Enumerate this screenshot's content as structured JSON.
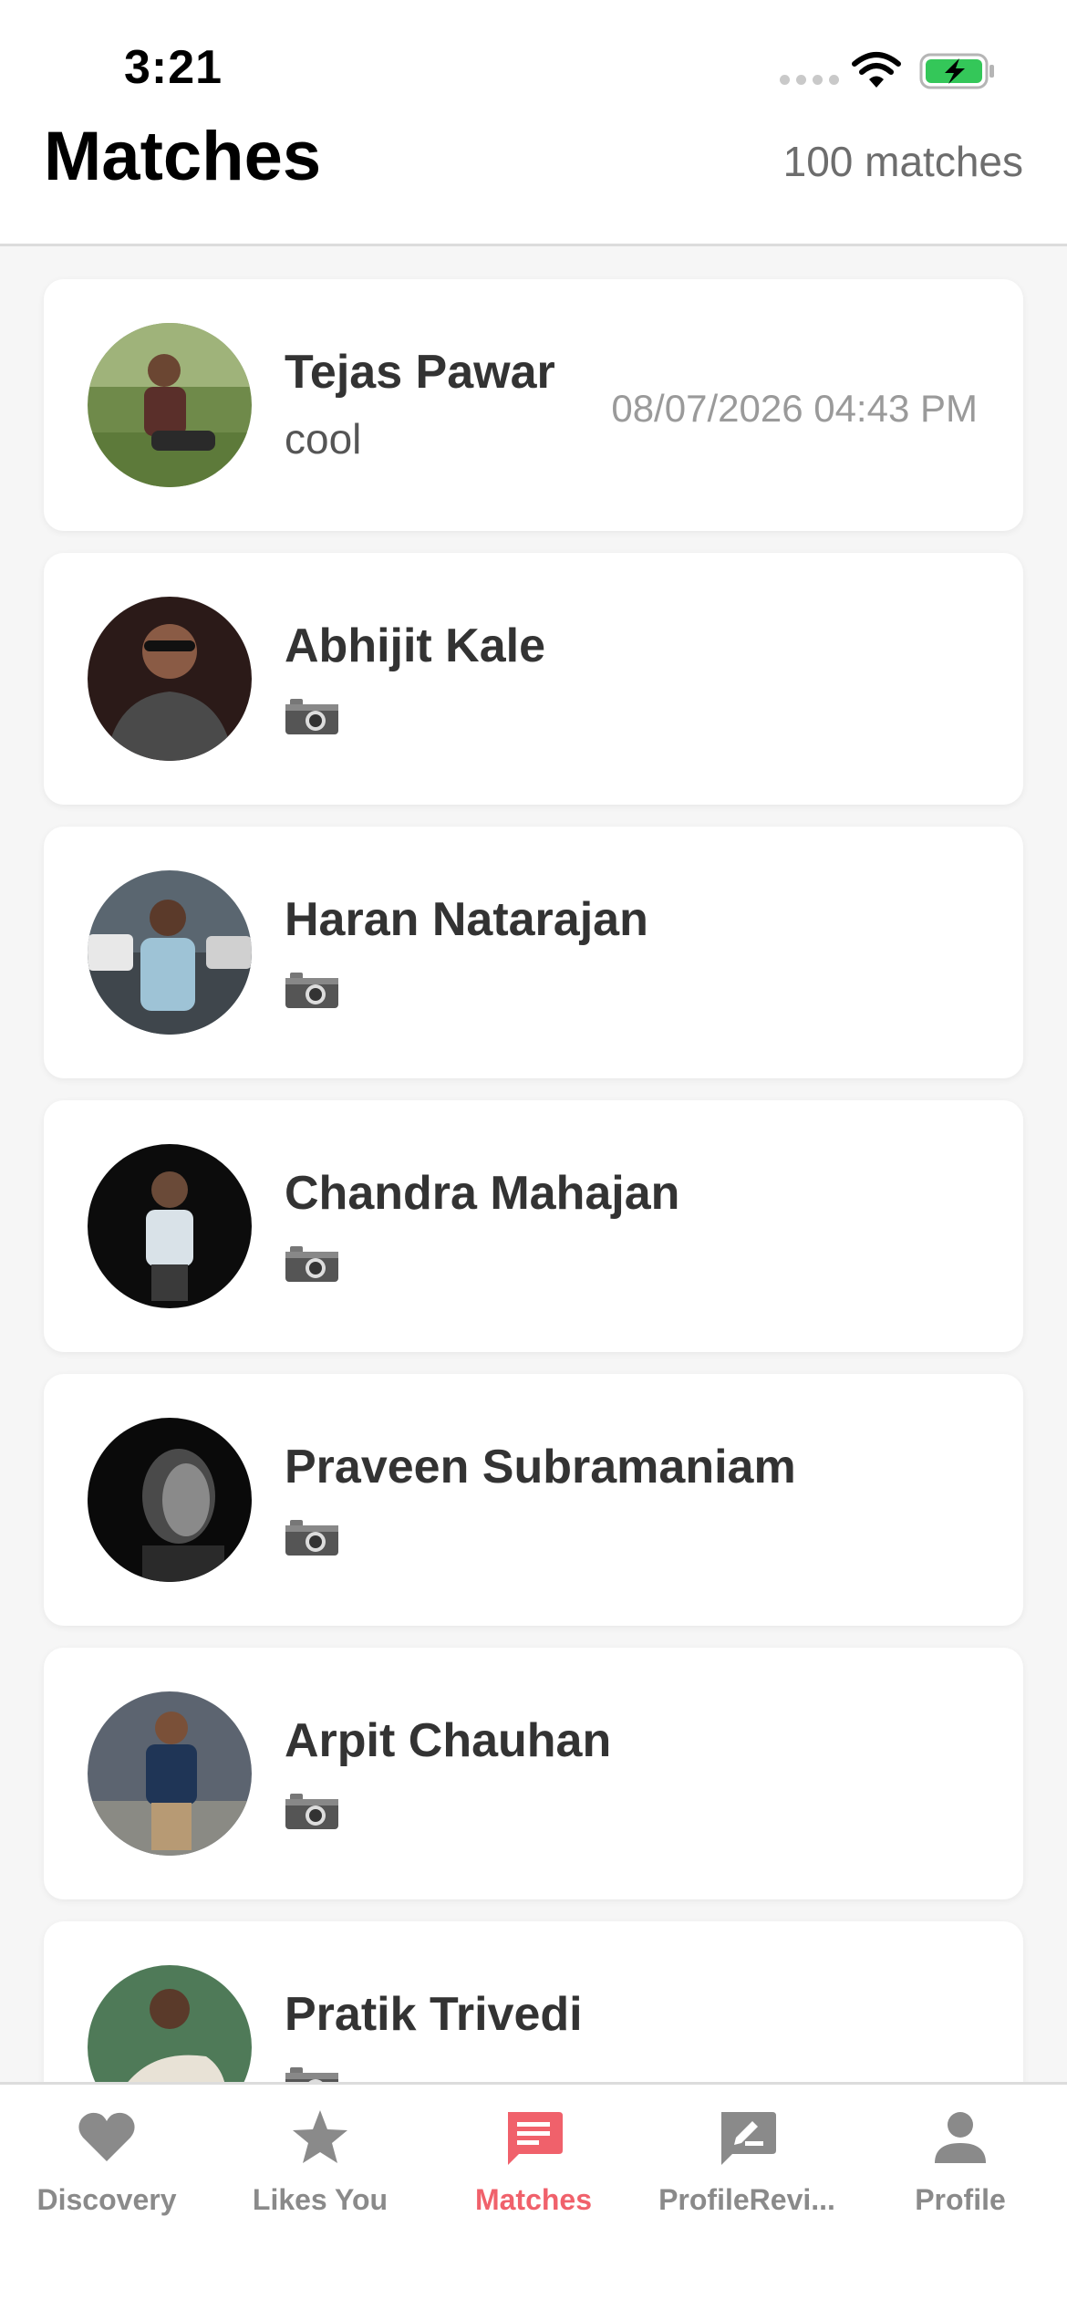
{
  "status_bar": {
    "time": "3:21"
  },
  "header": {
    "title": "Matches",
    "count_label": "100 matches"
  },
  "matches": [
    {
      "name": "Tejas Pawar",
      "last_message": "cool",
      "timestamp": "08/07/2026 04:43 PM"
    },
    {
      "name": "Abhijit Kale",
      "last_message_icon": "camera-icon"
    },
    {
      "name": "Haran Natarajan",
      "last_message_icon": "camera-icon"
    },
    {
      "name": "Chandra Mahajan",
      "last_message_icon": "camera-icon"
    },
    {
      "name": "Praveen Subramaniam",
      "last_message_icon": "camera-icon"
    },
    {
      "name": "Arpit Chauhan",
      "last_message_icon": "camera-icon"
    },
    {
      "name": "Pratik Trivedi",
      "last_message_icon": "camera-icon"
    }
  ],
  "tab_bar": {
    "tabs": [
      {
        "label": "Discovery",
        "icon": "heart-icon"
      },
      {
        "label": "Likes You",
        "icon": "star-icon"
      },
      {
        "label": "Matches",
        "icon": "chat-icon",
        "active": true
      },
      {
        "label": "ProfileRevi...",
        "icon": "edit-icon"
      },
      {
        "label": "Profile",
        "icon": "person-icon"
      }
    ]
  },
  "colors": {
    "accent": "#f0616b",
    "inactive": "#8a8a8a",
    "card_bg": "#ffffff"
  }
}
